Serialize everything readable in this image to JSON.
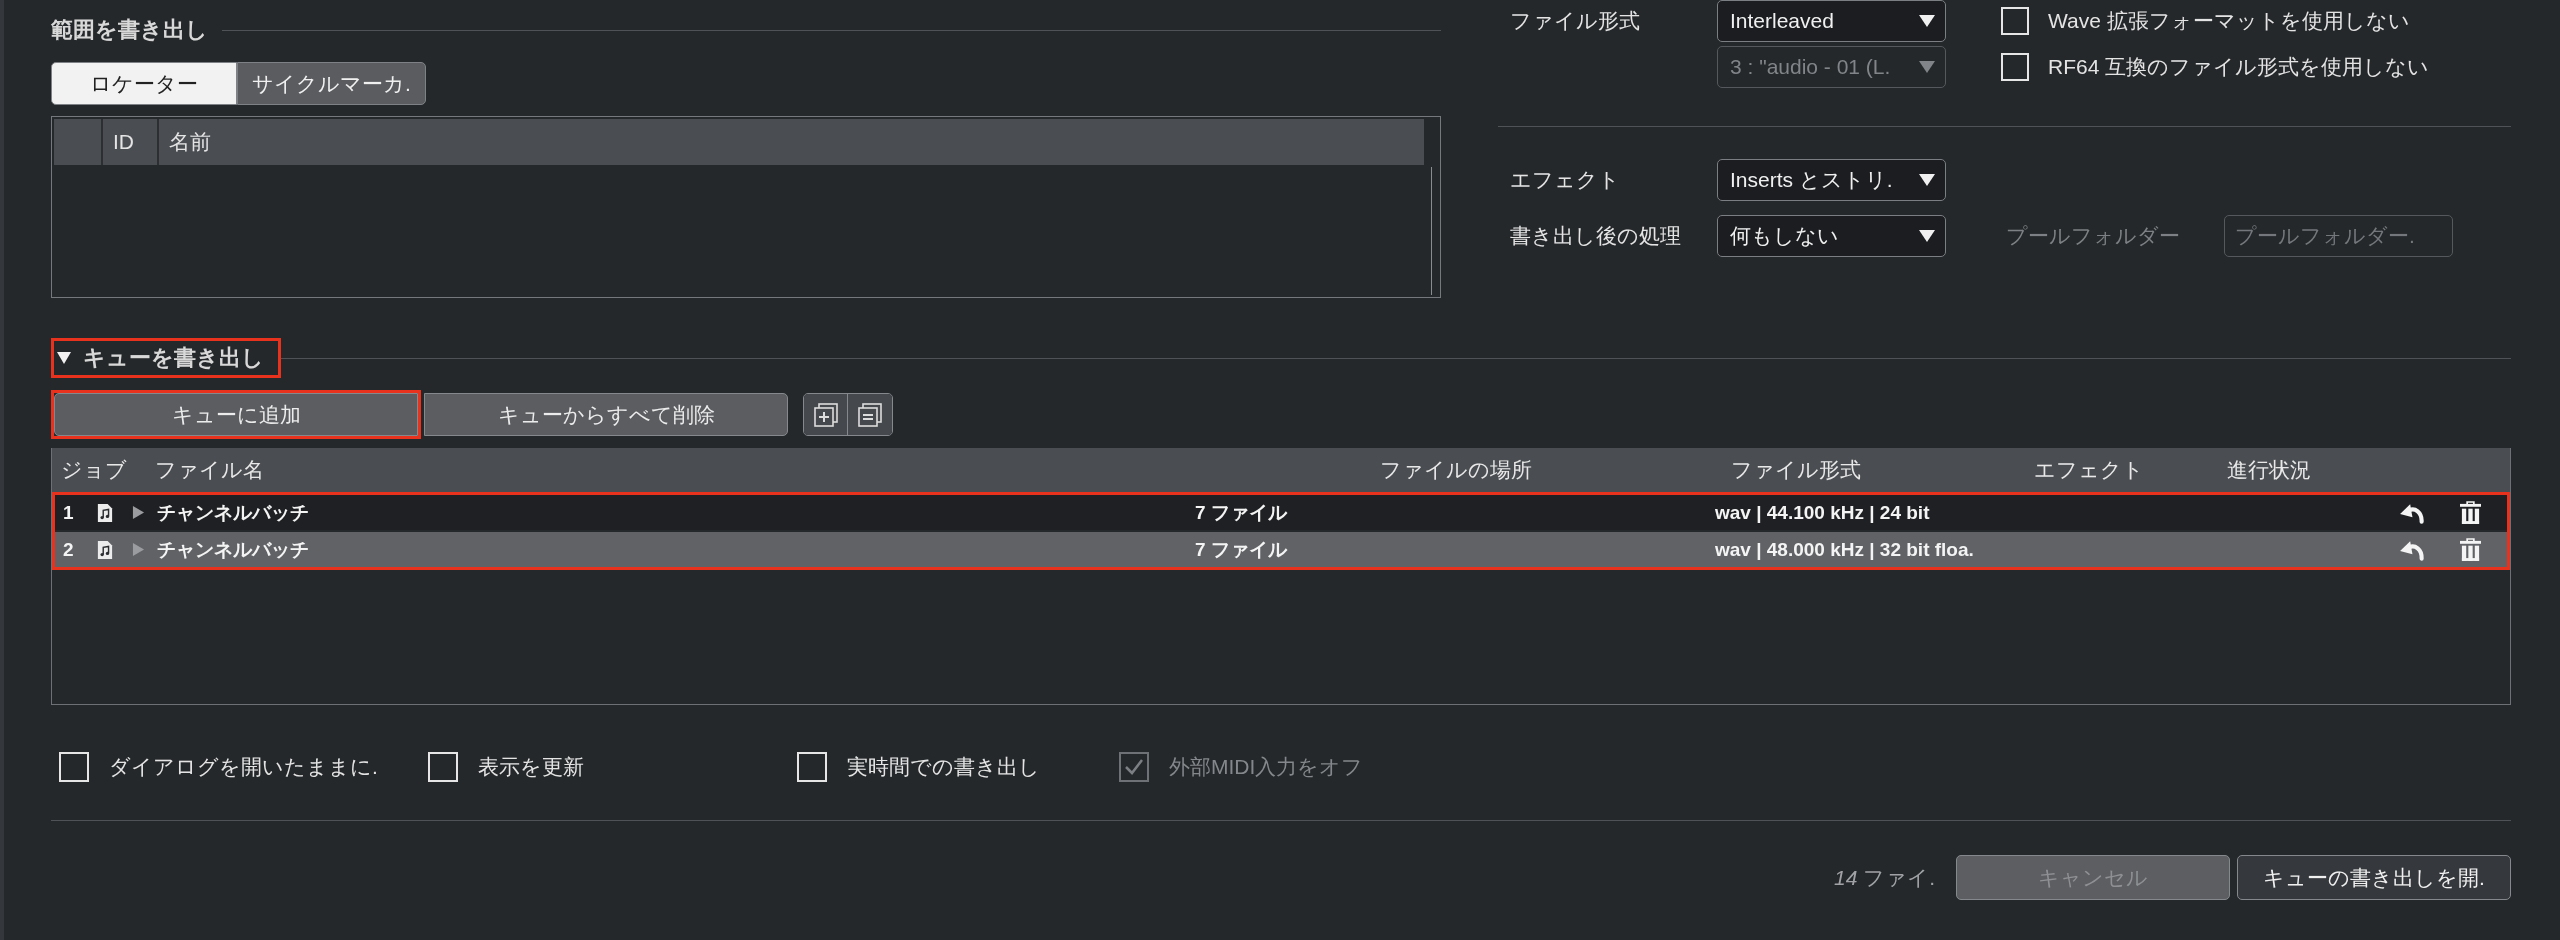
{
  "range_export": {
    "title": "範囲を書き出し",
    "tabs": [
      {
        "label": "ロケーター",
        "selected": true
      },
      {
        "label": "サイクルマーカ.",
        "selected": false
      }
    ],
    "table": {
      "columns": [
        "ID",
        "名前"
      ]
    }
  },
  "export_settings": {
    "sections": [
      {
        "rows": [
          {
            "label": "ファイル形式",
            "dropdown": {
              "value": "Interleaved",
              "disabled": false
            },
            "checkbox": {
              "label": "Wave 拡張フォーマットを使用しない",
              "checked": false
            }
          },
          {
            "dropdown": {
              "value": "3 : \"audio - 01 (L.",
              "disabled": true
            },
            "checkbox": {
              "label": "RF64 互換のファイル形式を使用しない",
              "checked": false
            }
          }
        ]
      },
      {
        "rows": [
          {
            "label": "エフェクト",
            "dropdown": {
              "value": "Inserts とストリ.",
              "disabled": false
            }
          },
          {
            "label": "書き出し後の処理",
            "dropdown": {
              "value": "何もしない",
              "disabled": false
            },
            "pool_folder": {
              "label": "プールフォルダー",
              "placeholder": "プールフォルダー.",
              "disabled": true
            }
          }
        ]
      }
    ]
  },
  "queue": {
    "title": "キューを書き出し",
    "expanded": true,
    "highlighted": true,
    "buttons": [
      {
        "label": "キューに追加",
        "highlighted": true
      },
      {
        "label": "キューからすべて削除",
        "highlighted": false
      }
    ],
    "icon_buttons": [
      {
        "kind": "plus"
      },
      {
        "kind": "minus"
      }
    ],
    "table": {
      "columns": [
        "ジョブ",
        "ファイル名",
        "ファイルの場所",
        "ファイル形式",
        "エフェクト",
        "進行状況"
      ],
      "rows_highlighted": true,
      "rows": [
        {
          "job": "1",
          "name": "チャンネルバッチ",
          "expanded": false,
          "files": "7 ファイル",
          "format": "wav | 44.100 kHz | 24 bit",
          "selected": false
        },
        {
          "job": "2",
          "name": "チャンネルバッチ",
          "expanded": false,
          "files": "7 ファイル",
          "format": "wav | 48.000 kHz | 32 bit floa.",
          "selected": true
        }
      ]
    }
  },
  "options": [
    {
      "label": "ダイアログを開いたままに.",
      "checked": false,
      "disabled": false
    },
    {
      "label": "表示を更新",
      "checked": false,
      "disabled": false
    },
    {
      "label": "実時間での書き出し",
      "checked": false,
      "disabled": false
    },
    {
      "label": "外部MIDI入力をオフ",
      "checked": true,
      "disabled": true
    }
  ],
  "footer": {
    "file_count": "*14* ファイ.",
    "buttons": [
      {
        "label": "キャンセル",
        "disabled": true
      },
      {
        "label": "キューの書き出しを開.",
        "disabled": false
      }
    ]
  }
}
